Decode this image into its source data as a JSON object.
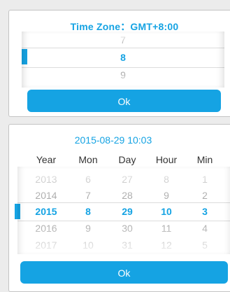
{
  "timezone_dialog": {
    "title": "Time Zone：GMT+8:00",
    "wheel": [
      "7",
      "8",
      "9"
    ],
    "selected_index": 1,
    "ok_label": "Ok"
  },
  "datetime_dialog": {
    "title": "2015-08-29 10:03",
    "columns": [
      "Year",
      "Mon",
      "Day",
      "Hour",
      "Min"
    ],
    "rows": [
      [
        "2013",
        "6",
        "27",
        "8",
        "1"
      ],
      [
        "2014",
        "7",
        "28",
        "9",
        "2"
      ],
      [
        "2015",
        "8",
        "29",
        "10",
        "3"
      ],
      [
        "2016",
        "9",
        "30",
        "11",
        "4"
      ],
      [
        "2017",
        "10",
        "31",
        "12",
        "5"
      ]
    ],
    "selected_row": 2,
    "ok_label": "Ok"
  },
  "colors": {
    "accent": "#15a3e3",
    "inactive_text": "#ababab",
    "background": "#ececec"
  }
}
